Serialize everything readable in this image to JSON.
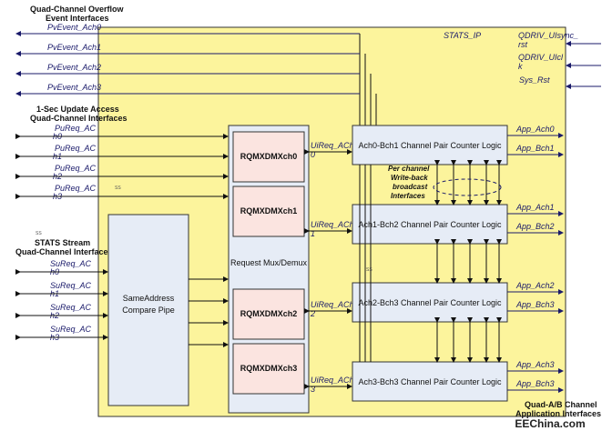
{
  "colors": {
    "ip_block": "#fcf49c",
    "block": "#e6ecf6",
    "rq_block": "#fbe4e0",
    "signal_text": "#1a1a6a",
    "wire": "#111111"
  },
  "headers": {
    "overflow_line1": "Quad-Channel Overflow",
    "overflow_line2": "Event Interfaces",
    "update_line1": "1-Sec Update Access",
    "update_line2": "Quad-Channel Interfaces",
    "stream_line1": "STATS Stream",
    "stream_line2": "Quad-Channel Interface",
    "app_line1": "Quad-A/B Channel",
    "app_line2": "Application Interfaces"
  },
  "ip_title": "STATS_IP",
  "pv_events": [
    "PvEvent_Ach0",
    "PvEvent_Ach1",
    "PvEvent_Ach2",
    "PvEvent_Ach3"
  ],
  "pu_req": [
    "PuReq_AC h0",
    "PuReq_AC h1",
    "PuReq_AC h2",
    "PuReq_AC h3"
  ],
  "su_req": [
    "SuReq_AC h0",
    "SuReq_AC h1",
    "SuReq_AC h2",
    "SuReq_AC h3"
  ],
  "ui_req": [
    "UiReq_ACh 0",
    "UiReq_ACh 1",
    "UiReq_ACh 2",
    "UiReq_ACh 3"
  ],
  "sys": {
    "qdriv_uisync": "QDRIV_UIsync_ rst",
    "qdriv_uiclk": "QDRIV_UIcl k",
    "sys_rst": "Sys_Rst"
  },
  "same_address": {
    "line1": "SameAddress",
    "line2": "Compare Pipe"
  },
  "request_mux": "Request Mux/Demux",
  "rq_blocks": [
    "RQMXDMXch0",
    "RQMXDMXch1",
    "RQMXDMXch2",
    "RQMXDMXch3"
  ],
  "counters": [
    "Ach0-Bch1 Channel Pair Counter Logic",
    "Ach1-Bch2 Channel Pair Counter Logic",
    "Ach2-Bch3 Channel Pair Counter Logic",
    "Ach3-Bch3 Channel Pair Counter Logic"
  ],
  "app_outputs": [
    "App_Ach0",
    "App_Bch1",
    "App_Ach1",
    "App_Bch2",
    "App_Ach2",
    "App_Bch3",
    "App_Ach3",
    "App_Bch3"
  ],
  "writeback_note": [
    "Per channel",
    "Write-back",
    "broadcast",
    "Interfaces"
  ],
  "watermark": "EEChina.com"
}
